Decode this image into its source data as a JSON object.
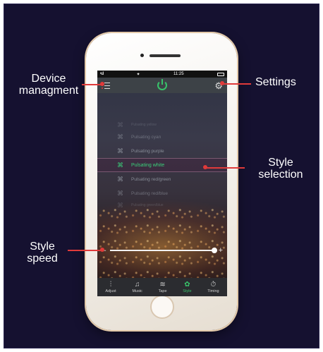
{
  "status_bar": {
    "signal": "•ull",
    "wifi": "✦",
    "time": "11:25"
  },
  "tab_bar": [
    {
      "icon": "adjust-sliders-icon",
      "glyph": "⫶",
      "label": "Adjust"
    },
    {
      "icon": "music-note-icon",
      "glyph": "♫",
      "label": "Music"
    },
    {
      "icon": "tape-icon",
      "glyph": "≋",
      "label": "Tape"
    },
    {
      "icon": "style-icon",
      "glyph": "✿",
      "label": "Style"
    },
    {
      "icon": "timer-icon",
      "glyph": "⏱",
      "label": "Timing"
    }
  ],
  "style_list": [
    {
      "symbol": "⌘",
      "label": "Pulsating yellow"
    },
    {
      "symbol": "⌘",
      "label": "Pulsating cyan"
    },
    {
      "symbol": "⌘",
      "label": "Pulsating purple"
    },
    {
      "symbol": "⌘",
      "label": "Pulsating white"
    },
    {
      "symbol": "⌘",
      "label": "Pulsating red/green"
    },
    {
      "symbol": "⌘",
      "label": "Pulsating red/blue"
    },
    {
      "symbol": "⌘",
      "label": "Pulsating green/blue"
    }
  ],
  "selected_style": "Pulsating white",
  "slider": {
    "minus": "–",
    "plus": "+",
    "value": 1.0
  },
  "callouts": {
    "device_management": "Device\nmanagment",
    "settings": "Settings",
    "style_selection": "Style\nselection",
    "style_speed": "Style\nspeed"
  },
  "colors": {
    "accent": "#38c26a",
    "leader": "#e03a3a",
    "background": "#151130"
  }
}
